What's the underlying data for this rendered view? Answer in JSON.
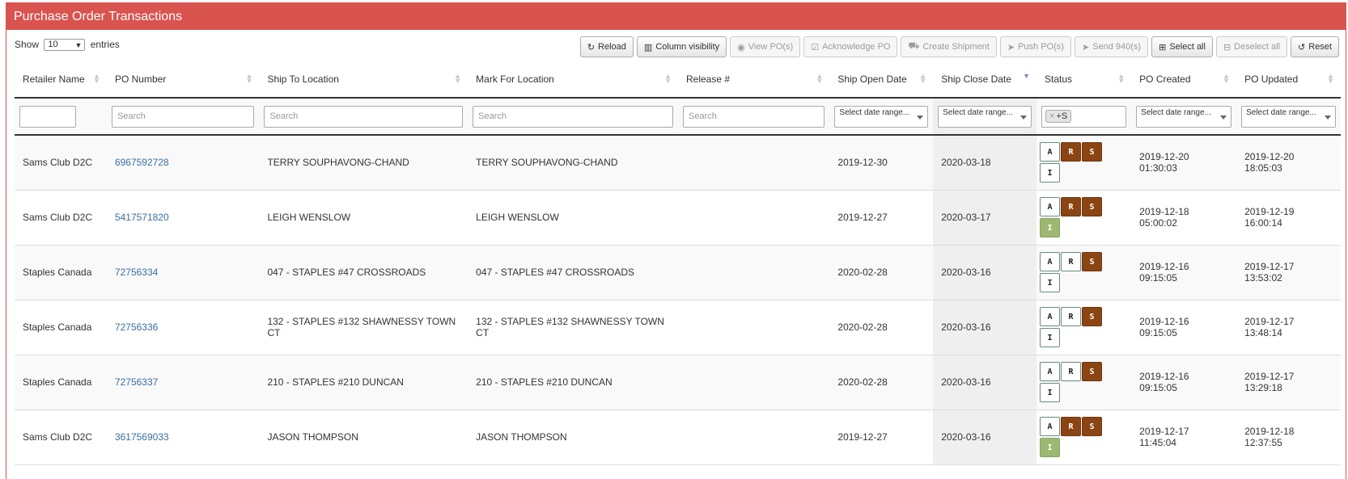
{
  "title": "Purchase Order Transactions",
  "entries": {
    "prefix": "Show",
    "value": "10",
    "suffix": "entries"
  },
  "toolbar": [
    {
      "name": "reload-button",
      "icon": "↻",
      "label": "Reload",
      "disabled": false
    },
    {
      "name": "column-visibility-button",
      "icon": "▥",
      "label": "Column visibility",
      "disabled": false
    },
    {
      "name": "view-pos-button",
      "icon": "◉",
      "label": "View PO(s)",
      "disabled": true
    },
    {
      "name": "acknowledge-po-button",
      "icon": "☑",
      "label": "Acknowledge PO",
      "disabled": true
    },
    {
      "name": "create-shipment-button",
      "icon": "⛟",
      "label": "Create Shipment",
      "disabled": true
    },
    {
      "name": "push-pos-button",
      "icon": "➤",
      "label": "Push PO(s)",
      "disabled": true
    },
    {
      "name": "send-940-button",
      "icon": "➤",
      "label": "Send 940(s)",
      "disabled": true
    },
    {
      "name": "select-all-button",
      "icon": "⊞",
      "label": "Select all",
      "disabled": false
    },
    {
      "name": "deselect-all-button",
      "icon": "⊟",
      "label": "Deselect all",
      "disabled": true
    },
    {
      "name": "reset-button",
      "icon": "↺",
      "label": "Reset",
      "disabled": false
    }
  ],
  "columns": [
    "Retailer Name",
    "PO Number",
    "Ship To Location",
    "Mark For Location",
    "Release #",
    "Ship Open Date",
    "Ship Close Date",
    "Status",
    "PO Created",
    "PO Updated"
  ],
  "filters": {
    "search_placeholder": "Search",
    "date_placeholder": "Select date range...",
    "status_tag": "+S",
    "status_tag_remove": "×"
  },
  "rows": [
    {
      "retailer": "Sams Club D2C",
      "po": "6967592728",
      "ship_to": "TERRY SOUPHAVONG-CHAND",
      "mark_for": "TERRY SOUPHAVONG-CHAND",
      "release": "",
      "open": "2019-12-30",
      "close": "2020-03-18",
      "status": [
        {
          "l": "A",
          "s": "white"
        },
        {
          "l": "R",
          "s": "brown"
        },
        {
          "l": "S",
          "s": "brown"
        },
        {
          "l": "I",
          "s": "white"
        }
      ],
      "created": "2019-12-20 01:30:03",
      "updated": "2019-12-20 18:05:03"
    },
    {
      "retailer": "Sams Club D2C",
      "po": "5417571820",
      "ship_to": "LEIGH WENSLOW",
      "mark_for": "LEIGH WENSLOW",
      "release": "",
      "open": "2019-12-27",
      "close": "2020-03-17",
      "status": [
        {
          "l": "A",
          "s": "white"
        },
        {
          "l": "R",
          "s": "brown"
        },
        {
          "l": "S",
          "s": "brown"
        },
        {
          "l": "I",
          "s": "green"
        }
      ],
      "created": "2019-12-18 05:00:02",
      "updated": "2019-12-19 16:00:14"
    },
    {
      "retailer": "Staples Canada",
      "po": "72756334",
      "ship_to": "047 - STAPLES #47 CROSSROADS",
      "mark_for": "047 - STAPLES #47 CROSSROADS",
      "release": "",
      "open": "2020-02-28",
      "close": "2020-03-16",
      "status": [
        {
          "l": "A",
          "s": "white"
        },
        {
          "l": "R",
          "s": "white"
        },
        {
          "l": "S",
          "s": "brown"
        },
        {
          "l": "I",
          "s": "white"
        }
      ],
      "created": "2019-12-16 09:15:05",
      "updated": "2019-12-17 13:53:02"
    },
    {
      "retailer": "Staples Canada",
      "po": "72756336",
      "ship_to": "132 - STAPLES #132 SHAWNESSY TOWN CT",
      "mark_for": "132 - STAPLES #132 SHAWNESSY TOWN CT",
      "release": "",
      "open": "2020-02-28",
      "close": "2020-03-16",
      "status": [
        {
          "l": "A",
          "s": "white"
        },
        {
          "l": "R",
          "s": "white"
        },
        {
          "l": "S",
          "s": "brown"
        },
        {
          "l": "I",
          "s": "white"
        }
      ],
      "created": "2019-12-16 09:15:05",
      "updated": "2019-12-17 13:48:14"
    },
    {
      "retailer": "Staples Canada",
      "po": "72756337",
      "ship_to": "210 - STAPLES #210 DUNCAN",
      "mark_for": "210 - STAPLES #210 DUNCAN",
      "release": "",
      "open": "2020-02-28",
      "close": "2020-03-16",
      "status": [
        {
          "l": "A",
          "s": "white"
        },
        {
          "l": "R",
          "s": "white"
        },
        {
          "l": "S",
          "s": "brown"
        },
        {
          "l": "I",
          "s": "white"
        }
      ],
      "created": "2019-12-16 09:15:05",
      "updated": "2019-12-17 13:29:18"
    },
    {
      "retailer": "Sams Club D2C",
      "po": "3617569033",
      "ship_to": "JASON THOMPSON",
      "mark_for": "JASON THOMPSON",
      "release": "",
      "open": "2019-12-27",
      "close": "2020-03-16",
      "status": [
        {
          "l": "A",
          "s": "white"
        },
        {
          "l": "R",
          "s": "brown"
        },
        {
          "l": "S",
          "s": "brown"
        },
        {
          "l": "I",
          "s": "green"
        }
      ],
      "created": "2019-12-17 11:45:04",
      "updated": "2019-12-18 12:37:55"
    }
  ],
  "colors": {
    "header": "#d9534f",
    "link": "#3a6ea5",
    "badge_brown": "#8b4513",
    "badge_green": "#9db871"
  }
}
